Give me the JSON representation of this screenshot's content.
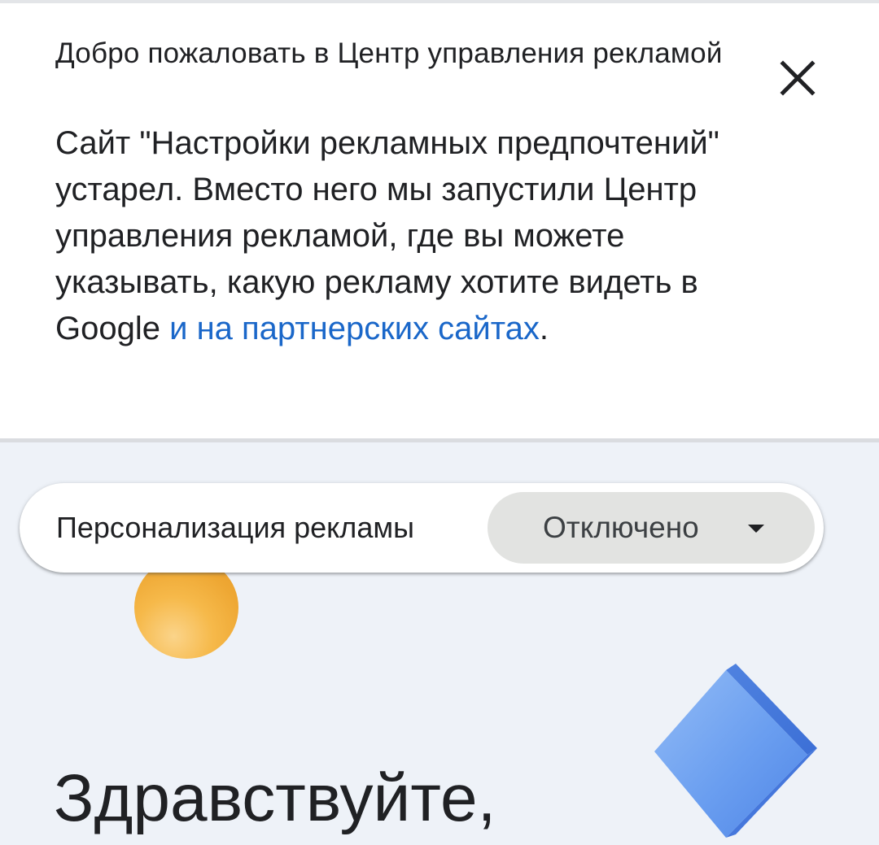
{
  "banner": {
    "title": "Добро пожаловать в Центр управления рекламой",
    "body_text": "Сайт \"Настройки рекламных предпочтений\" устарел. Вместо него мы запустили Центр управления рекламой, где вы можете указывать, какую рекламу хотите видеть в Google ",
    "link_text": "и на партнерских сайтах",
    "trailing_punct": ".",
    "close_icon": "close-icon"
  },
  "ad_personalization": {
    "label": "Персонализация рекламы",
    "selected_value": "Отключено",
    "dropdown_icon": "dropdown-arrow-icon"
  },
  "hero": {
    "greeting": "Здравствуйте,"
  },
  "colors": {
    "link": "#1a67c9",
    "page_background": "#eef2f8",
    "select_background": "#e2e3e1",
    "orb": "#f2b041",
    "diamond": "#5b8fe8"
  }
}
